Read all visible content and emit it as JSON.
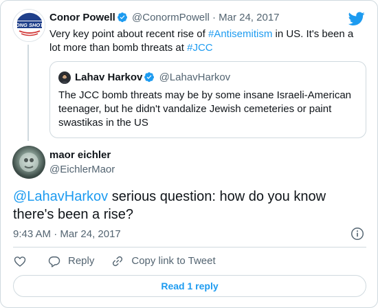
{
  "colors": {
    "accent": "#1d9bf0",
    "secondary_text": "#536471",
    "border": "#cfd9de"
  },
  "parent_tweet": {
    "avatar_icon": "long-shots-logo",
    "avatar_text": "LONG SHOTS",
    "name": "Conor Powell",
    "handle": "@ConormPowell",
    "separator": "·",
    "date": "Mar 24, 2017",
    "text_part1": "Very key point about recent rise of ",
    "hashtag1": "#Antisemitism",
    "text_part2": " in US. It's been a lot more than bomb threats at ",
    "hashtag2": "#JCC"
  },
  "quoted_tweet": {
    "name": "Lahav Harkov",
    "handle": "@LahavHarkov",
    "text": "The JCC bomb threats may be by some insane Israeli-American teenager, but he didn't vandalize Jewish cemeteries or paint swastikas in the US"
  },
  "main_tweet": {
    "name": "maor eichler",
    "handle": "@EichlerMaor",
    "mention": "@LahavHarkov",
    "text": " serious question: how do you know there's been a rise?",
    "time": "9:43 AM",
    "separator": "·",
    "date": "Mar 24, 2017"
  },
  "actions": {
    "reply_label": "Reply",
    "copy_label": "Copy link to Tweet"
  },
  "read_replies_label": "Read 1 reply"
}
